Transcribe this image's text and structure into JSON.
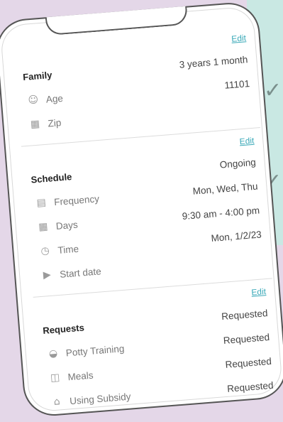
{
  "family": {
    "edit": "Edit",
    "title": "Family",
    "value": "3 years 1 month",
    "rows": [
      {
        "label": "Age",
        "value": "11101",
        "icon": "child-face-icon"
      },
      {
        "label": "Zip",
        "value": "",
        "icon": "map-icon"
      }
    ]
  },
  "schedule": {
    "edit": "Edit",
    "title": "Schedule",
    "value": "Ongoing",
    "rows": [
      {
        "label": "Frequency",
        "value": "Mon, Wed, Thu",
        "icon": "clipboard-icon"
      },
      {
        "label": "Days",
        "value": "9:30 am - 4:00 pm",
        "icon": "calendar-icon"
      },
      {
        "label": "Time",
        "value": "Mon, 1/2/23",
        "icon": "clock-icon"
      },
      {
        "label": "Start date",
        "value": "",
        "icon": "calendar-play-icon"
      }
    ]
  },
  "requests": {
    "edit": "Edit",
    "title": "Requests",
    "value": "Requested",
    "rows": [
      {
        "label": "Potty Training",
        "value": "Requested",
        "icon": "potty-icon"
      },
      {
        "label": "Meals",
        "value": "Requested",
        "icon": "meal-icon"
      },
      {
        "label": "Using Subsidy",
        "value": "Requested",
        "icon": "building-icon"
      }
    ]
  },
  "colors": {
    "accent": "#3aa9b8",
    "background": "#e4d7e8",
    "teal_panel": "#c9e8e3"
  }
}
